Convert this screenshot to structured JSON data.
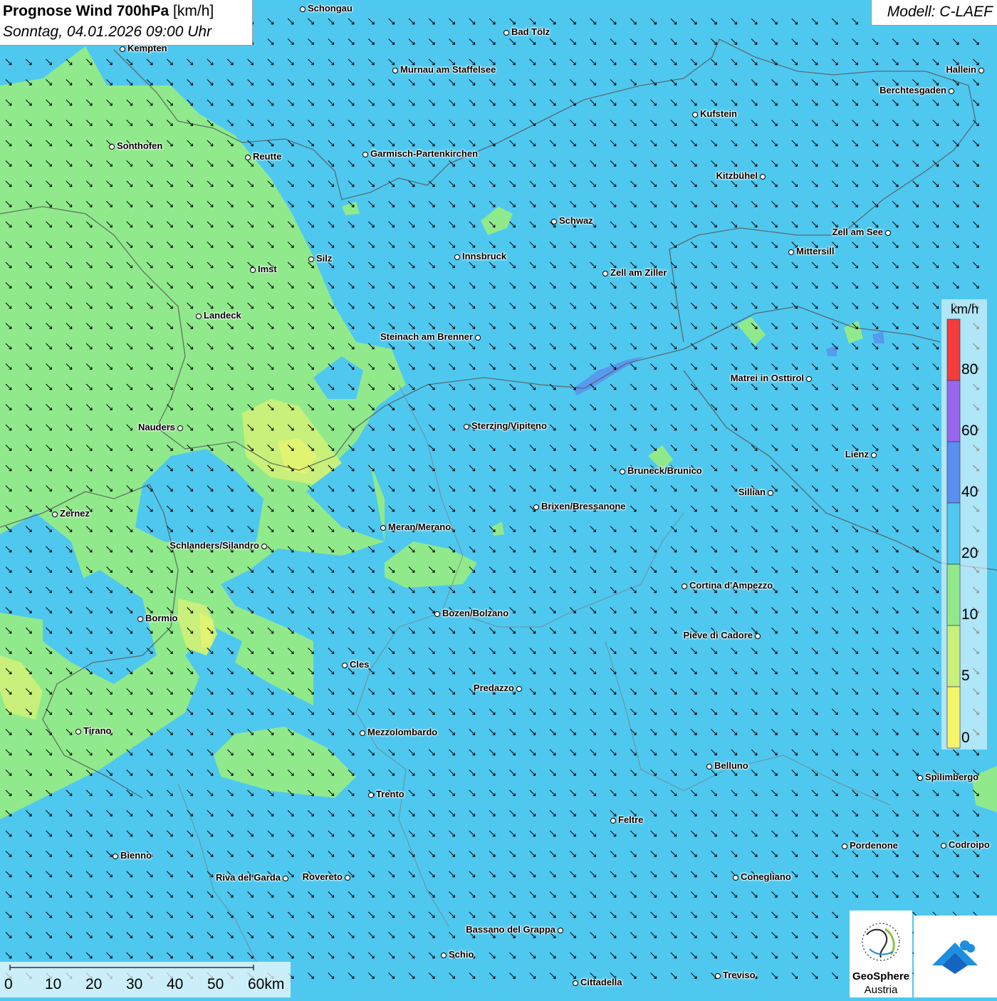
{
  "header": {
    "title_bold": "Prognose Wind 700hPa",
    "title_unit": " [km/h]",
    "date": "Sonntag, 04.01.2026 09:00 Uhr"
  },
  "model": {
    "label": "Modell: C-LAEF"
  },
  "colors": {
    "wind_0_5": "#f5f56a",
    "wind_5_10": "#c8f07a",
    "wind_10_20": "#90ea8c",
    "wind_20_40": "#4fc8ef",
    "wind_40_60": "#5a8ef0",
    "wind_60_80": "#9a66ee",
    "wind_80_plus": "#f53b3b"
  },
  "legend": {
    "unit": "km/h",
    "ticks": [
      "80",
      "60",
      "40",
      "20",
      "10",
      "5",
      "0"
    ]
  },
  "scale_bar": {
    "labels": [
      "0",
      "10",
      "20",
      "30",
      "40",
      "50",
      "60km"
    ]
  },
  "logo": {
    "line1": "GeoSphere",
    "line2": "Austria"
  },
  "cities": [
    {
      "name": "Schongau"
    },
    {
      "name": "Bad Tölz"
    },
    {
      "name": "Kempten"
    },
    {
      "name": "Murnau am Staffelsee"
    },
    {
      "name": "Hallein"
    },
    {
      "name": "Berchtesgaden"
    },
    {
      "name": "Kufstein"
    },
    {
      "name": "Sonthofen"
    },
    {
      "name": "Reutte"
    },
    {
      "name": "Garmisch-Partenkirchen"
    },
    {
      "name": "Kitzbühel"
    },
    {
      "name": "Schwaz"
    },
    {
      "name": "Zell am See"
    },
    {
      "name": "Mittersill"
    },
    {
      "name": "Innsbruck"
    },
    {
      "name": "Silz"
    },
    {
      "name": "Imst"
    },
    {
      "name": "Zell am Ziller"
    },
    {
      "name": "Landeck"
    },
    {
      "name": "Steinach am Brenner"
    },
    {
      "name": "Matrei in Osttirol"
    },
    {
      "name": "Nauders"
    },
    {
      "name": "Sterzing/Vipiteno"
    },
    {
      "name": "Lienz"
    },
    {
      "name": "Bruneck/Brunico"
    },
    {
      "name": "Sillian"
    },
    {
      "name": "Brixen/Bressanone"
    },
    {
      "name": "Zernez"
    },
    {
      "name": "Meran/Merano"
    },
    {
      "name": "Schlanders/Silandro"
    },
    {
      "name": "Cortina d'Ampezzo"
    },
    {
      "name": "Bozen/Bolzano"
    },
    {
      "name": "Bormio"
    },
    {
      "name": "Pieve di Cadore"
    },
    {
      "name": "Cles"
    },
    {
      "name": "Predazzo"
    },
    {
      "name": "Tirano"
    },
    {
      "name": "Mezzolombardo"
    },
    {
      "name": "Belluno"
    },
    {
      "name": "Spilimbergo"
    },
    {
      "name": "Trento"
    },
    {
      "name": "Feltre"
    },
    {
      "name": "Bienno"
    },
    {
      "name": "Pordenone"
    },
    {
      "name": "Codroipo"
    },
    {
      "name": "Riva del Garda"
    },
    {
      "name": "Rovereto"
    },
    {
      "name": "Conegliano"
    },
    {
      "name": "Bassano del Grappa"
    },
    {
      "name": "Schio"
    },
    {
      "name": "Treviso"
    },
    {
      "name": "Cittadella"
    }
  ]
}
